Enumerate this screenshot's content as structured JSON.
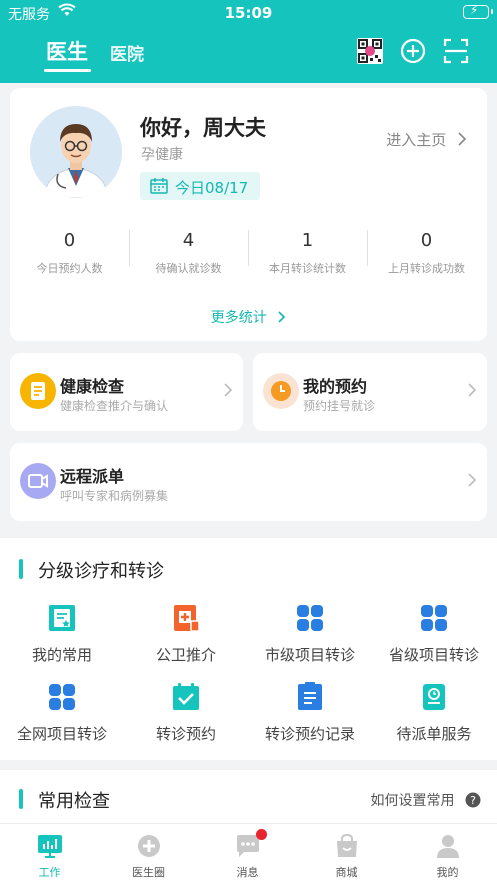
{
  "status_bar": {
    "carrier": "无服务",
    "time": "15:09"
  },
  "header": {
    "tabs": [
      {
        "label": "医生",
        "active": true
      },
      {
        "label": "医院",
        "active": false
      }
    ],
    "icons": [
      "qrcode-icon",
      "add-circle-icon",
      "scan-icon"
    ]
  },
  "profile": {
    "greeting": "你好，周大夫",
    "org": "孕健康",
    "date": "今日08/17",
    "enter_home": "进入主页",
    "stats": [
      {
        "value": "0",
        "label": "今日预约人数"
      },
      {
        "value": "4",
        "label": "待确认就诊数"
      },
      {
        "value": "1",
        "label": "本月转诊统计数"
      },
      {
        "value": "0",
        "label": "上月转诊成功数"
      }
    ],
    "more": "更多统计"
  },
  "services": [
    {
      "title": "健康检查",
      "subtitle": "健康检查推介与确认",
      "icon": "report-icon",
      "color": "#f7b500"
    },
    {
      "title": "我的预约",
      "subtitle": "预约挂号就诊",
      "icon": "clock-icon",
      "color": "#f59a23"
    },
    {
      "title": "远程派单",
      "subtitle": "呼叫专家和病例募集",
      "icon": "video-icon",
      "color": "#8b8ef0"
    }
  ],
  "graded": {
    "title": "分级诊疗和转诊",
    "items": [
      {
        "label": "我的常用",
        "icon": "favorite-doc-icon"
      },
      {
        "label": "公卫推介",
        "icon": "medical-doc-icon"
      },
      {
        "label": "市级项目转诊",
        "icon": "grid-icon"
      },
      {
        "label": "省级项目转诊",
        "icon": "grid-icon"
      },
      {
        "label": "全网项目转诊",
        "icon": "grid-icon"
      },
      {
        "label": "转诊预约",
        "icon": "calendar-check-icon"
      },
      {
        "label": "转诊预约记录",
        "icon": "list-doc-icon"
      },
      {
        "label": "待派单服务",
        "icon": "clipboard-clock-icon"
      }
    ]
  },
  "common_checks": {
    "title": "常用检查",
    "help": "如何设置常用"
  },
  "tabbar": [
    {
      "label": "工作",
      "active": true,
      "icon": "chart-icon"
    },
    {
      "label": "医生圈",
      "active": false,
      "icon": "doctor-circle-icon"
    },
    {
      "label": "消息",
      "active": false,
      "icon": "message-icon",
      "badge": true
    },
    {
      "label": "商城",
      "active": false,
      "icon": "shop-bag-icon"
    },
    {
      "label": "我的",
      "active": false,
      "icon": "person-icon"
    }
  ],
  "colors": {
    "primary": "#14c4bd",
    "blue_icon": "#2a7de1",
    "orange_icon": "#f2642c"
  }
}
